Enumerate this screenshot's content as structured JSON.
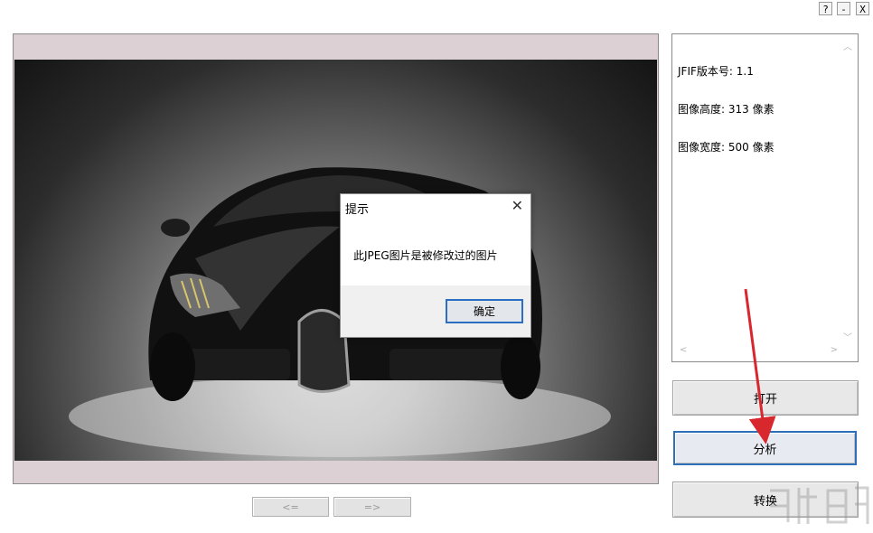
{
  "window": {
    "help_label": "?",
    "minimize_label": "-",
    "close_label": "X"
  },
  "info_panel": {
    "lines": [
      "JFIF版本号: 1.1",
      "图像高度: 313 像素",
      "图像宽度: 500 像素"
    ]
  },
  "buttons": {
    "open_label": "打开",
    "analyze_label": "分析",
    "convert_label": "转换",
    "prev_label": "<=",
    "next_label": "=>"
  },
  "dialog": {
    "title": "提示",
    "close_glyph": "✕",
    "message": "此JPEG图片是被修改过的图片",
    "ok_label": "确定"
  },
  "colors": {
    "accent": "#2f6fb8",
    "arrow": "#d9272e",
    "viewer_bg": "#d9cdd1"
  }
}
